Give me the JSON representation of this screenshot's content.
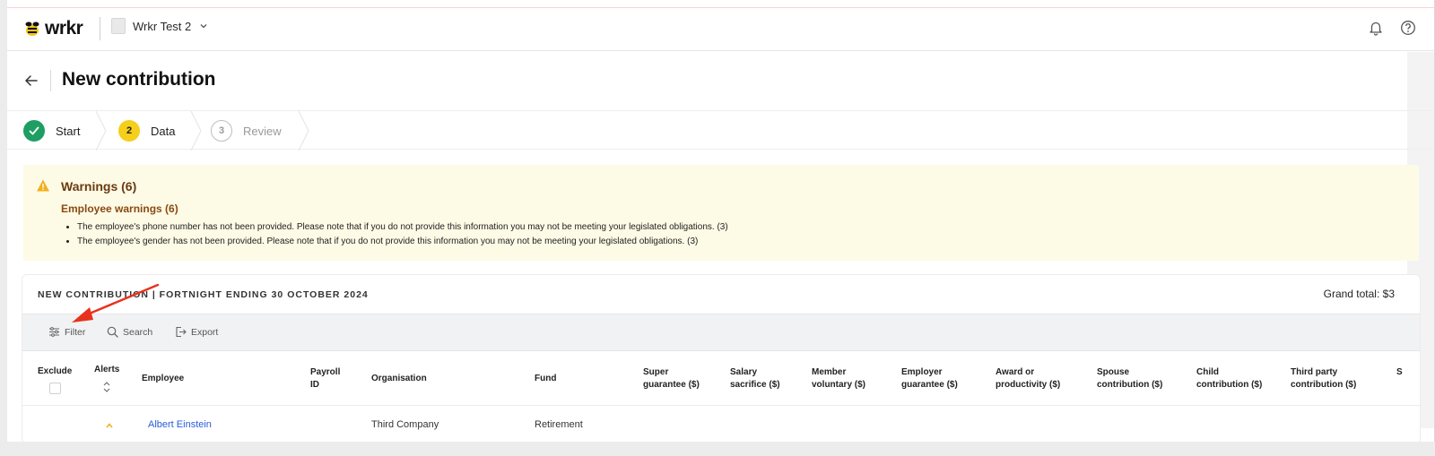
{
  "app": {
    "brand": "wrkr",
    "workspace": "Wrkr Test 2"
  },
  "page": {
    "title": "New contribution"
  },
  "stepper": {
    "steps": [
      {
        "number": "",
        "label": "Start",
        "state": "complete"
      },
      {
        "number": "2",
        "label": "Data",
        "state": "active"
      },
      {
        "number": "3",
        "label": "Review",
        "state": "pending"
      }
    ]
  },
  "warnings": {
    "title": "Warnings (6)",
    "subtitle": "Employee warnings (6)",
    "items": [
      "The employee's phone number has not been provided. Please note that if you do not provide this information you may not be meeting your legislated obligations. (3)",
      "The employee's gender has not been provided. Please note that if you do not provide this information you may not be meeting your legislated obligations. (3)"
    ]
  },
  "contribution": {
    "heading": "NEW CONTRIBUTION | FORTNIGHT ENDING 30 OCTOBER 2024",
    "grand_total_label": "Grand total: $3",
    "toolbar": {
      "filter_label": "Filter",
      "search_label": "Search",
      "export_label": "Export"
    },
    "columns": {
      "exclude": "Exclude",
      "alerts": "Alerts",
      "employee": "Employee",
      "payroll_1": "Payroll",
      "payroll_2": "ID",
      "organisation": "Organisation",
      "fund": "Fund",
      "super_1": "Super",
      "super_2": "guarantee ($)",
      "salary_1": "Salary",
      "salary_2": "sacrifice ($)",
      "member_1": "Member",
      "member_2": "voluntary ($)",
      "employer_1": "Employer",
      "employer_2": "guarantee ($)",
      "award_1": "Award or",
      "award_2": "productivity ($)",
      "spouse_1": "Spouse",
      "spouse_2": "contribution ($)",
      "child_1": "Child",
      "child_2": "contribution ($)",
      "third_1": "Third party",
      "third_2": "contribution ($)",
      "more": "S"
    },
    "rows": [
      {
        "employee": "Albert Einstein",
        "organisation": "Third Company",
        "fund": "Retirement"
      }
    ]
  },
  "colors": {
    "complete": "#1e9e63",
    "active": "#f5cf1a",
    "warning_bg": "#fdfbe6",
    "warning_title": "#6b3a10",
    "link": "#2a5bd7",
    "annotation": "#e8321e"
  }
}
